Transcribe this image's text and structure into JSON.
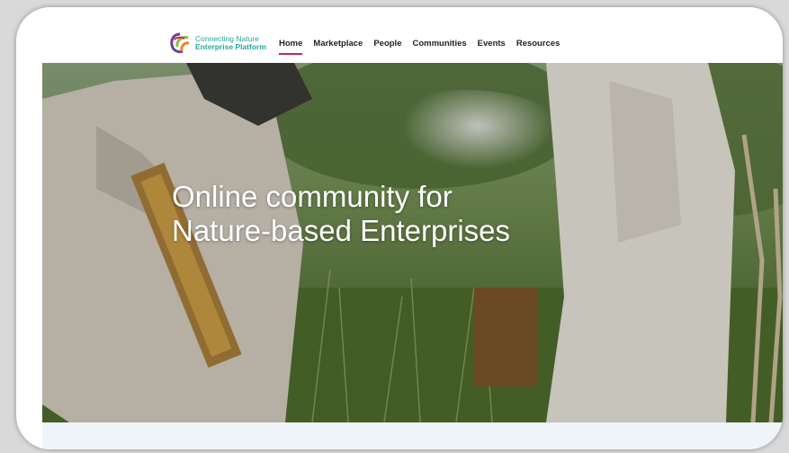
{
  "header": {
    "logo": {
      "line1": "Connecting Nature",
      "line2": "Enterprise Platform",
      "icon": "leaf-logo-icon"
    },
    "nav": [
      {
        "label": "Home",
        "active": true
      },
      {
        "label": "Marketplace",
        "active": false
      },
      {
        "label": "People",
        "active": false
      },
      {
        "label": "Communities",
        "active": false
      },
      {
        "label": "Events",
        "active": false
      },
      {
        "label": "Resources",
        "active": false
      }
    ]
  },
  "hero": {
    "title_line1": "Online community for",
    "title_line2": "Nature-based Enterprises"
  },
  "colors": {
    "brand_teal": "#23a9a0",
    "nav_active_underline": "#c0246b",
    "nav_text": "#222222"
  }
}
